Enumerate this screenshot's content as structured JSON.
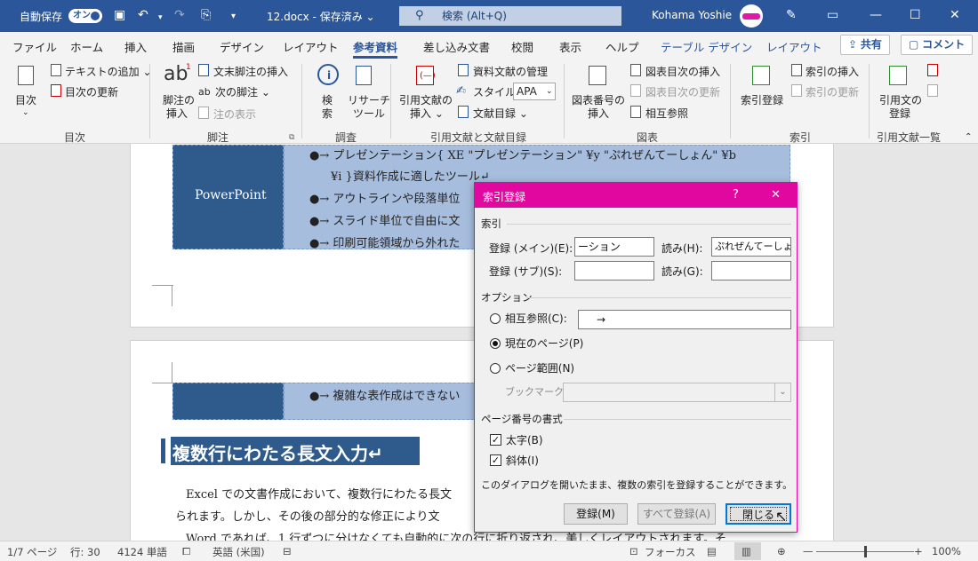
{
  "titlebar": {
    "autosave_label": "自動保存",
    "autosave_toggle": "オン",
    "document_title": "12.docx - 保存済み",
    "dropdown_glyph": "⌄",
    "search_placeholder": "検索 (Alt+Q)",
    "user_name": "Kohama Yoshie",
    "bg_color": "#2b579a"
  },
  "tabs": [
    "ファイル",
    "ホーム",
    "挿入",
    "描画",
    "デザイン",
    "レイアウト",
    "参考資料",
    "差し込み文書",
    "校閲",
    "表示",
    "ヘルプ",
    "テーブル デザイン",
    "レイアウト"
  ],
  "active_tab": "参考資料",
  "share_label": "共有",
  "comment_label": "コメント",
  "ribbon": {
    "toc": {
      "btn_line1": "目次",
      "add_text": "テキストの追加",
      "update_toc": "目次の更新",
      "group": "目次"
    },
    "footnotes": {
      "insert_footnote_l1": "脚注の",
      "insert_footnote_l2": "挿入",
      "insert_endnote": "文末脚注の挿入",
      "next_footnote": "次の脚注",
      "show_notes": "注の表示",
      "ab_glyph": "ab",
      "superscript": "1",
      "group": "脚注"
    },
    "research": {
      "search": "検索",
      "researcher_l1": "リサーチ",
      "researcher_l2": "ツール",
      "group": "調査"
    },
    "citations": {
      "insert_citation_l1": "引用文献の",
      "insert_citation_l2": "挿入",
      "manage_sources": "資料文献の管理",
      "style_label": "スタイル:",
      "style_value": "APA",
      "bibliography": "文献目録",
      "group": "引用文献と文献目録"
    },
    "captions": {
      "insert_caption_l1": "図表番号の",
      "insert_caption_l2": "挿入",
      "insert_tof": "図表目次の挿入",
      "update_table": "図表目次の更新",
      "cross_ref": "相互参照",
      "group": "図表"
    },
    "index": {
      "mark_entry": "索引登録",
      "insert_index": "索引の挿入",
      "update_index": "索引の更新",
      "group": "索引"
    },
    "toa": {
      "mark_citation_l1": "引用文の",
      "mark_citation_l2": "登録",
      "group": "引用文献一覧"
    }
  },
  "document": {
    "table_cell_label": "PowerPoint",
    "bullets": [
      "●→ プレゼンテーション{ XE \"プレゼンテーション\" ¥y \"ぷれぜんてーしょん\" ¥b",
      "¥i }資料作成に適したツール↵",
      "●→ アウトラインや段落単位",
      "●→ スライド単位で自由に文",
      "●→ 印刷可能領域から外れた"
    ],
    "page2_bullet": "●→ 複雑な表作成はできない",
    "heading": "複数行にわたる長文入力↵",
    "body_lines": [
      "Excel での文書作成において、複数行にわたる長文",
      "られます。しかし、その後の部分的な修正により文",
      "Word であれば、1 行ずつに分けなくても自動的に次の行に折り返され、美しくレイアウトされます。そ"
    ],
    "table_dark_color": "#2e5b8c",
    "table_light_color": "#a7bddd"
  },
  "dialog": {
    "title": "索引登録",
    "help": "?",
    "close_x": "✕",
    "section_index": "索引",
    "main_entry_label": "登録 (メイン)(E):",
    "main_entry_value": "ーション",
    "reading1_label": "読み(H):",
    "reading1_value": "ぷれぜんてーしょん",
    "sub_entry_label": "登録 (サブ)(S):",
    "sub_entry_value": "",
    "reading2_label": "読み(G):",
    "reading2_value": "",
    "section_options": "オプション",
    "cross_ref_label": "相互参照(C):",
    "cross_ref_value": "→",
    "current_page_label": "現在のページ(P)",
    "page_range_label": "ページ範囲(N)",
    "bookmark_label": "ブックマーク:",
    "section_format": "ページ番号の書式",
    "bold_label": "太字(B)",
    "italic_label": "斜体(I)",
    "info_text": "このダイアログを開いたまま、複数の索引を登録することができます。",
    "mark_button": "登録(M)",
    "mark_all_button": "すべて登録(A)",
    "close_button": "閉じる",
    "accent_color": "#e0089e"
  },
  "statusbar": {
    "page": "1/7 ページ",
    "line": "行: 30",
    "words": "4124 単語",
    "language": "英語 (米国)",
    "focus": "フォーカス",
    "zoom": "100%"
  }
}
